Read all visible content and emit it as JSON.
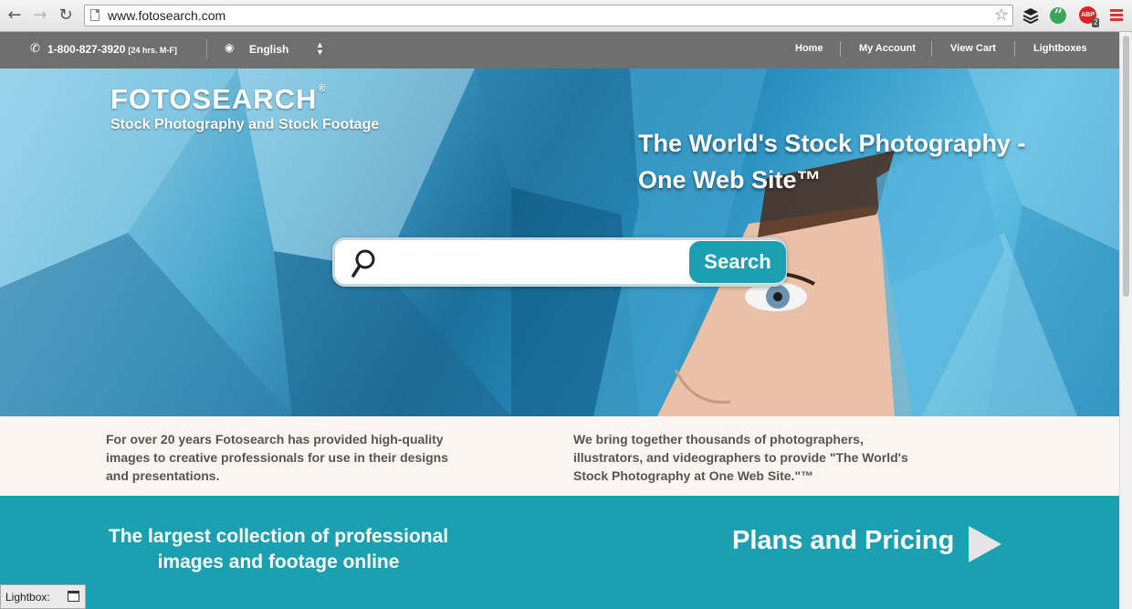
{
  "browser": {
    "url": "www.fotosearch.com",
    "abp_label": "ABP",
    "abp_count": "2"
  },
  "topbar": {
    "phone": "1-800-827-3920",
    "phone_hours": "[24 hrs. M-F]",
    "language": "English",
    "links": [
      "Home",
      "My Account",
      "View Cart",
      "Lightboxes"
    ]
  },
  "hero": {
    "logo": "FOTOSEARCH",
    "logo_mark": "®",
    "tagline": "Stock Photography and Stock Footage",
    "headline": "The World's Stock Photography - One Web Site™",
    "search_value": "",
    "search_button": "Search"
  },
  "intro": {
    "left": "For over 20 years Fotosearch has provided high-quality images to creative professionals for use in their designs and presentations.",
    "right": "We bring together thousands of photographers, illustrators, and videographers to provide \"The World's Stock Photography at One Web Site.\"™"
  },
  "promo": {
    "left_text": "The largest collection of professional images and footage online",
    "right_text": "Plans and Pricing"
  },
  "lightbox": {
    "label": "Lightbox:"
  },
  "colors": {
    "topbar": "#6f6f6f",
    "accent_teal": "#1aa0b0",
    "intro_bg": "#fdf5f2"
  }
}
